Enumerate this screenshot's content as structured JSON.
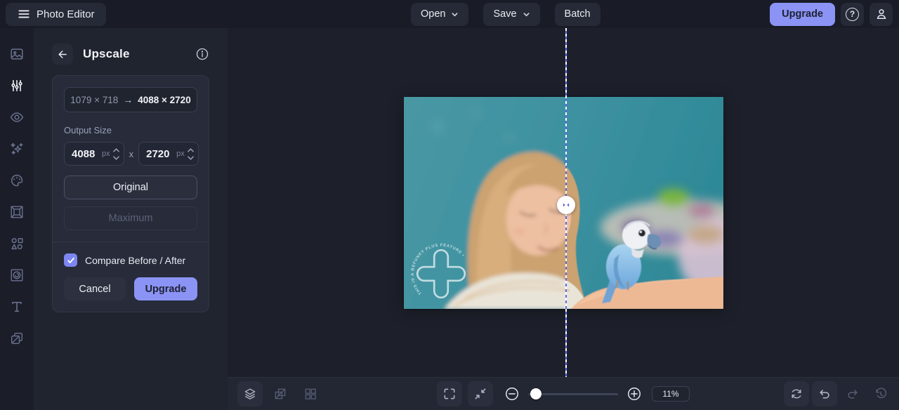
{
  "topbar": {
    "app_title": "Photo Editor",
    "open_label": "Open",
    "save_label": "Save",
    "batch_label": "Batch",
    "upgrade_label": "Upgrade",
    "help_glyph": "?"
  },
  "sidebar": {
    "icons": [
      "image-manager-icon",
      "edit-sliders-icon",
      "touchup-eye-icon",
      "effects-sparkles-icon",
      "artsy-palette-icon",
      "frames-icon",
      "graphics-shapes-icon",
      "textures-icon",
      "text-icon",
      "layers-duplicate-icon"
    ],
    "active_index": 1
  },
  "panel": {
    "title": "Upscale",
    "size_before": "1079 × 718",
    "size_arrow": "→",
    "size_after": "4088 × 2720",
    "output_size_label": "Output Size",
    "width_value": "4088",
    "height_value": "2720",
    "unit": "px",
    "dimension_separator": "x",
    "original_label": "Original",
    "maximum_label": "Maximum",
    "compare_label": "Compare Before / After",
    "compare_checked": true,
    "cancel_label": "Cancel",
    "upgrade_label": "Upgrade"
  },
  "canvas": {
    "watermark_text": "THIS IS A BEFUNKY PLUS FEATURE •",
    "zoom_percent": "11%"
  },
  "colors": {
    "accent_purple": "#8b93f4",
    "checkbox_purple": "#7d86f2",
    "compare_line_blue": "#5b68ea",
    "photo_teal": "#3d91a0",
    "topbar_bg": "#191c26",
    "panel_bg": "#20242f",
    "canvas_bg": "#1d202b"
  }
}
